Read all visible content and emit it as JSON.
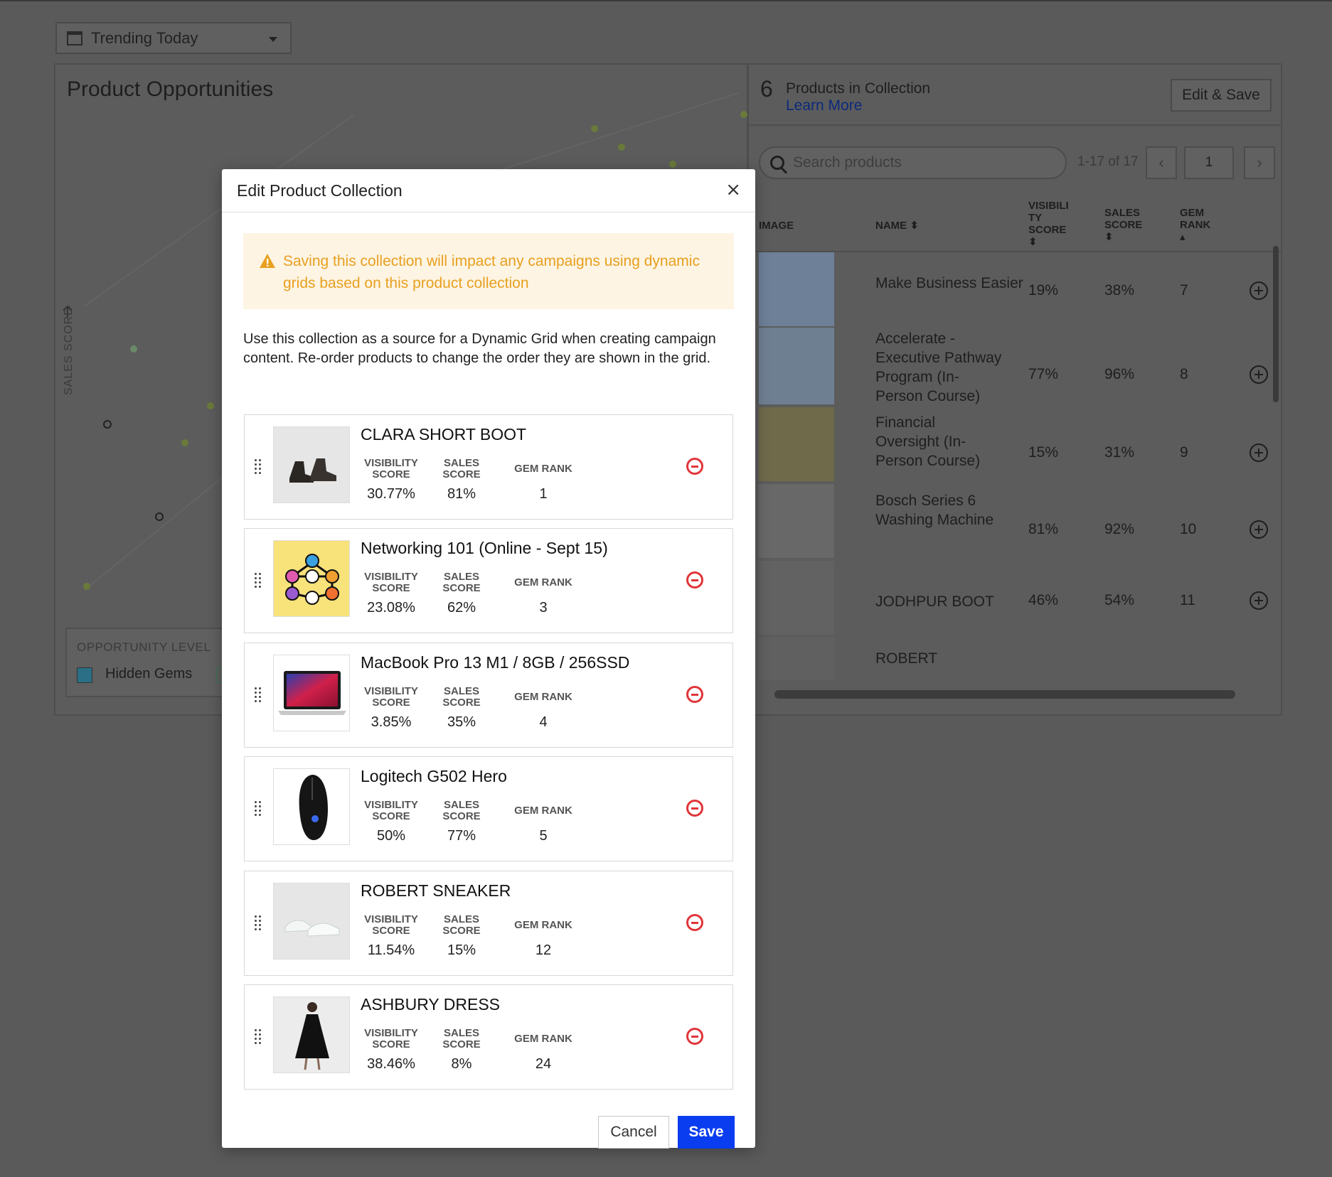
{
  "background": {
    "date_filter": "Trending Today",
    "opportunities": {
      "title": "Product Opportunities",
      "y_axis_label": "SALES SCORE",
      "legend_title": "OPPORTUNITY LEVEL",
      "legend_item": "Hidden Gems"
    },
    "collection": {
      "count": "6",
      "heading": "Products in Collection",
      "learn_more": "Learn More",
      "edit_save": "Edit & Save",
      "search_placeholder": "Search products",
      "pager_text": "1-17 of 17",
      "page": "1",
      "columns": [
        "IMAGE",
        "NAME",
        "VISIBILI TY SCORE",
        "SALES SCORE",
        "GEM RANK"
      ],
      "rows": [
        {
          "name": "Make Business Easier",
          "visibility": "19%",
          "sales": "38%",
          "rank": "7"
        },
        {
          "name": "Accelerate - Executive Pathway Program (In-Person Course)",
          "visibility": "77%",
          "sales": "96%",
          "rank": "8"
        },
        {
          "name": "Financial Oversight (In-Person Course)",
          "visibility": "15%",
          "sales": "31%",
          "rank": "9"
        },
        {
          "name": "Bosch Series 6 Washing Machine",
          "visibility": "81%",
          "sales": "92%",
          "rank": "10"
        },
        {
          "name": "JODHPUR BOOT",
          "visibility": "46%",
          "sales": "54%",
          "rank": "11"
        },
        {
          "name": "ROBERT",
          "visibility": "",
          "sales": "",
          "rank": ""
        }
      ]
    }
  },
  "modal": {
    "title": "Edit Product Collection",
    "close": "×",
    "warning": "Saving this collection will impact any campaigns using dynamic grids based on this product collection",
    "description": "Use this collection as a source for a Dynamic Grid when creating campaign content. Re-order products to change the order they are shown in the grid.",
    "metric_labels": {
      "visibility": "VISIBILITY SCORE",
      "sales": "SALES SCORE",
      "rank": "GEM RANK"
    },
    "products": [
      {
        "name": "CLARA SHORT BOOT",
        "visibility": "30.77%",
        "sales": "81%",
        "rank": "1"
      },
      {
        "name": "Networking 101 (Online - Sept 15)",
        "visibility": "23.08%",
        "sales": "62%",
        "rank": "3"
      },
      {
        "name": "MacBook Pro 13 M1 / 8GB / 256SSD",
        "visibility": "3.85%",
        "sales": "35%",
        "rank": "4"
      },
      {
        "name": "Logitech G502 Hero",
        "visibility": "50%",
        "sales": "77%",
        "rank": "5"
      },
      {
        "name": "ROBERT SNEAKER",
        "visibility": "11.54%",
        "sales": "15%",
        "rank": "12"
      },
      {
        "name": "ASHBURY DRESS",
        "visibility": "38.46%",
        "sales": "8%",
        "rank": "24"
      }
    ],
    "cancel": "Cancel",
    "save": "Save"
  },
  "colors": {
    "accent": "#0a3cf0",
    "warning_text": "#e8a020",
    "warning_bg": "#fdf4e3",
    "remove": "#e0353a"
  }
}
